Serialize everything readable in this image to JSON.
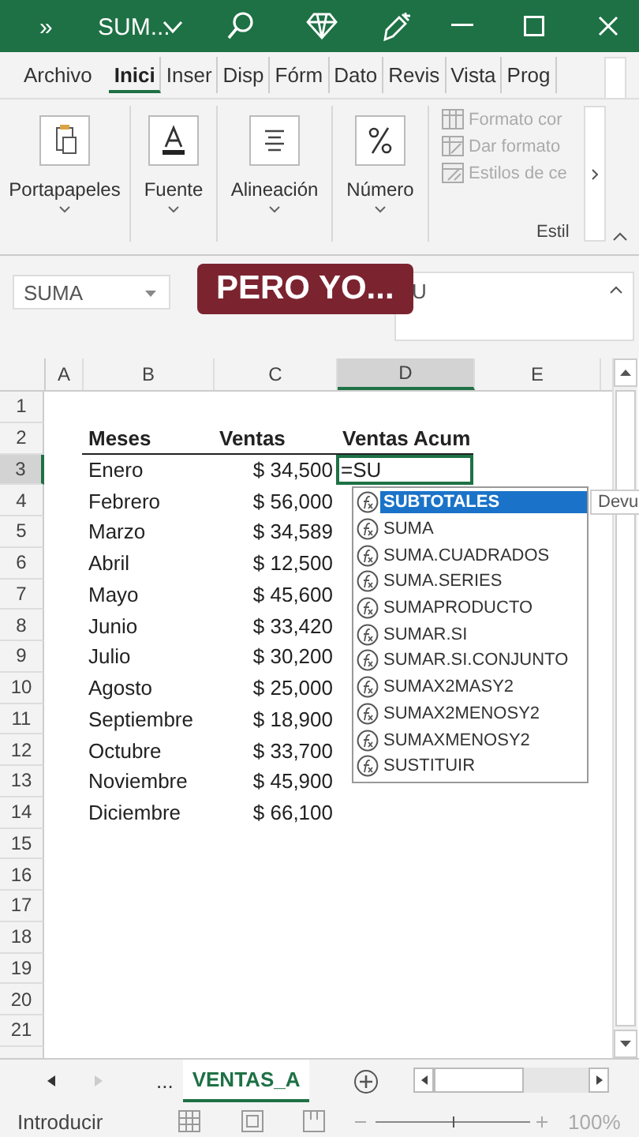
{
  "title_bar": {
    "overflow": "»",
    "title": "SUM..."
  },
  "ribbon_tabs": [
    {
      "label": "Archivo",
      "selected": false
    },
    {
      "label": "Inici",
      "selected": true
    },
    {
      "label": "Inser",
      "selected": false
    },
    {
      "label": "Disp",
      "selected": false
    },
    {
      "label": "Fórm",
      "selected": false
    },
    {
      "label": "Dato",
      "selected": false
    },
    {
      "label": "Revis",
      "selected": false
    },
    {
      "label": "Vista",
      "selected": false
    },
    {
      "label": "Prog",
      "selected": false
    }
  ],
  "ribbon_groups": [
    {
      "kind": "clipboard",
      "label": "Portapapeles"
    },
    {
      "kind": "font",
      "label": "Fuente"
    },
    {
      "kind": "align",
      "label": "Alineación"
    },
    {
      "kind": "number",
      "label": "Número"
    }
  ],
  "styles_group": {
    "label": "Estil",
    "items": [
      {
        "kind": "table",
        "label": "Formato cor",
        "disabled": true
      },
      {
        "kind": "format",
        "label": "Dar formato",
        "disabled": true
      },
      {
        "kind": "cell",
        "label": "Estilos de ce",
        "disabled": true
      }
    ]
  },
  "name_box": {
    "value": "SUMA"
  },
  "formula_bar": {
    "value": "U"
  },
  "caption": "PERO YO...",
  "columns": [
    {
      "label": "A",
      "selected": false
    },
    {
      "label": "B",
      "selected": false
    },
    {
      "label": "C",
      "selected": false
    },
    {
      "label": "D",
      "selected": true
    },
    {
      "label": "E",
      "selected": false
    }
  ],
  "rows": [
    {
      "number": "1",
      "selected": false
    },
    {
      "number": "2",
      "selected": false,
      "header": true,
      "cells": [
        "Meses",
        "Ventas",
        "Ventas Acum"
      ]
    },
    {
      "number": "3",
      "selected": true,
      "cells": [
        "Enero",
        "$ 34,500",
        "=SU"
      ]
    },
    {
      "number": "4",
      "selected": false,
      "cells": [
        "Febrero",
        "$ 56,000"
      ]
    },
    {
      "number": "5",
      "selected": false,
      "cells": [
        "Marzo",
        "$ 34,589"
      ]
    },
    {
      "number": "6",
      "selected": false,
      "cells": [
        "Abril",
        "$ 12,500"
      ]
    },
    {
      "number": "7",
      "selected": false,
      "cells": [
        "Mayo",
        "$ 45,600"
      ]
    },
    {
      "number": "8",
      "selected": false,
      "cells": [
        "Junio",
        "$ 33,420"
      ]
    },
    {
      "number": "9",
      "selected": false,
      "cells": [
        "Julio",
        "$ 30,200"
      ]
    },
    {
      "number": "10",
      "selected": false,
      "cells": [
        "Agosto",
        "$ 25,000"
      ]
    },
    {
      "number": "11",
      "selected": false,
      "cells": [
        "Septiembre",
        "$ 18,900"
      ]
    },
    {
      "number": "12",
      "selected": false,
      "cells": [
        "Octubre",
        "$ 33,700"
      ]
    },
    {
      "number": "13",
      "selected": false,
      "cells": [
        "Noviembre",
        "$ 45,900"
      ]
    },
    {
      "number": "14",
      "selected": false,
      "cells": [
        "Diciembre",
        "$ 66,100"
      ]
    },
    {
      "number": "15",
      "selected": false
    },
    {
      "number": "16",
      "selected": false
    },
    {
      "number": "17",
      "selected": false
    },
    {
      "number": "18",
      "selected": false
    },
    {
      "number": "19",
      "selected": false
    },
    {
      "number": "20",
      "selected": false
    },
    {
      "number": "21",
      "selected": false
    }
  ],
  "autocomplete": [
    {
      "label": "SUBTOTALES",
      "selected": true
    },
    {
      "label": "SUMA",
      "selected": false
    },
    {
      "label": "SUMA.CUADRADOS",
      "selected": false
    },
    {
      "label": "SUMA.SERIES",
      "selected": false
    },
    {
      "label": "SUMAPRODUCTO",
      "selected": false
    },
    {
      "label": "SUMAR.SI",
      "selected": false
    },
    {
      "label": "SUMAR.SI.CONJUNTO",
      "selected": false
    },
    {
      "label": "SUMAX2MASY2",
      "selected": false
    },
    {
      "label": "SUMAX2MENOSY2",
      "selected": false
    },
    {
      "label": "SUMAXMENOSY2",
      "selected": false
    },
    {
      "label": "SUSTITUIR",
      "selected": false
    }
  ],
  "tooltip": "Devu",
  "sheet_tabs": [
    {
      "label": "...",
      "selected": false
    },
    {
      "label": "VENTAS_A",
      "selected": true
    }
  ],
  "status_bar": {
    "mode": "Introducir",
    "zoom": "100%",
    "zoom_slider": {
      "level": 0.5
    }
  }
}
